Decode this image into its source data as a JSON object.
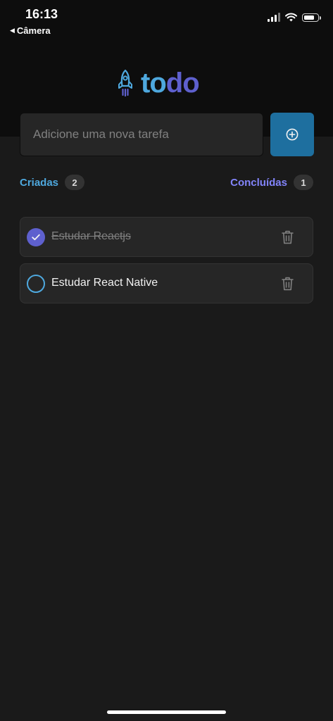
{
  "status_bar": {
    "time": "16:13",
    "back_label": "Câmera",
    "back_icon": "triangle-left-icon",
    "icons": [
      "cellular-signal-icon",
      "wifi-icon",
      "battery-icon"
    ]
  },
  "header": {
    "logo_icon": "rocket-icon",
    "logo_part1": "to",
    "logo_part2": "do"
  },
  "new_task": {
    "placeholder": "Adicione uma nova tarefa",
    "value": "",
    "add_button_icon": "plus-circle-icon"
  },
  "counters": {
    "created_label": "Criadas",
    "created_count": "2",
    "done_label": "Concluídas",
    "done_count": "1"
  },
  "tasks": [
    {
      "title": "Estudar Reactjs",
      "done": true
    },
    {
      "title": "Estudar React Native",
      "done": false
    }
  ],
  "colors": {
    "background": "#1a1a1a",
    "header_background": "#0d0d0d",
    "blue": "#4ea8de",
    "blue_dark": "#1e6f9f",
    "purple": "#5e60ce",
    "purple_light": "#8284fa",
    "card": "#262626"
  }
}
